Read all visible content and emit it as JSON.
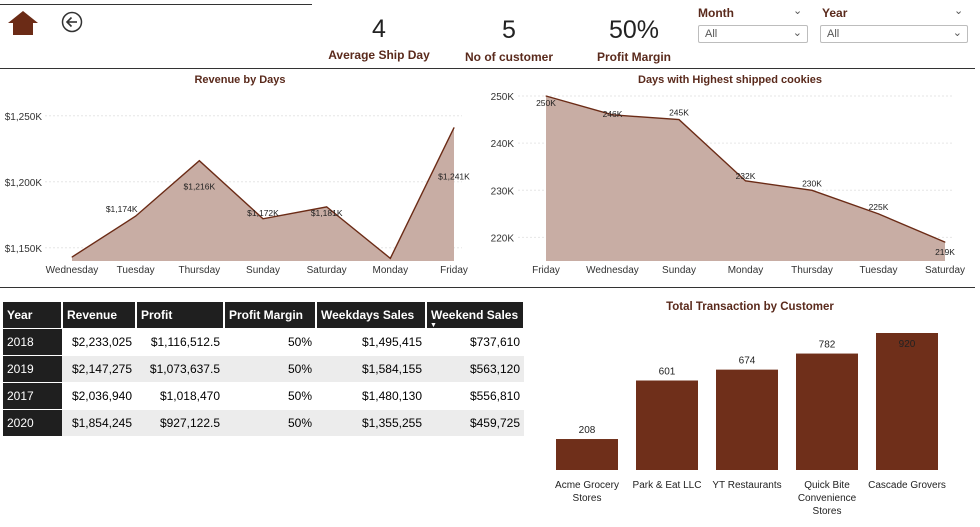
{
  "header": {
    "home_icon": "home-icon",
    "back_icon": "back-arrow-icon",
    "kpis": [
      {
        "value": "4",
        "label": "Average Ship Day"
      },
      {
        "value": "5",
        "label": "No of customer"
      },
      {
        "value": "50%",
        "label": "Profit Margin"
      }
    ],
    "slicers": [
      {
        "title": "Month",
        "value": "All"
      },
      {
        "title": "Year",
        "value": "All"
      }
    ]
  },
  "colors": {
    "accent": "#6b2b16",
    "area_fill": "#c8ada4",
    "area_line": "#6b2b16",
    "bar": "#6f2f1a",
    "table_header": "#1f1f1f"
  },
  "table": {
    "columns": [
      "Year",
      "Revenue",
      "Profit",
      "Profit Margin",
      "Weekdays Sales",
      "Weekend Sales"
    ],
    "sort_column": "Weekend Sales",
    "rows": [
      [
        "2018",
        "$2,233,025",
        "$1,116,512.5",
        "50%",
        "$1,495,415",
        "$737,610"
      ],
      [
        "2019",
        "$2,147,275",
        "$1,073,637.5",
        "50%",
        "$1,584,155",
        "$563,120"
      ],
      [
        "2017",
        "$2,036,940",
        "$1,018,470",
        "50%",
        "$1,480,130",
        "$556,810"
      ],
      [
        "2020",
        "$1,854,245",
        "$927,122.5",
        "50%",
        "$1,355,255",
        "$459,725"
      ]
    ]
  },
  "chart_data": [
    {
      "type": "area",
      "title": "Revenue by Days",
      "categories": [
        "Wednesday",
        "Tuesday",
        "Thursday",
        "Sunday",
        "Saturday",
        "Monday",
        "Friday"
      ],
      "values": [
        1143,
        1174,
        1216,
        1172,
        1181,
        1142,
        1241
      ],
      "data_labels": [
        "",
        "$1,174K",
        "$1,216K",
        "$1,172K",
        "$1,181K",
        "",
        "$1,241K"
      ],
      "yticks": [
        1150,
        1200,
        1250
      ],
      "ytick_labels": [
        "$1,150K",
        "$1,200K",
        "$1,250K"
      ],
      "ylim": [
        1140,
        1265
      ],
      "grid": true
    },
    {
      "type": "area",
      "title": "Days with Highest shipped cookies",
      "categories": [
        "Friday",
        "Wednesday",
        "Sunday",
        "Monday",
        "Thursday",
        "Tuesday",
        "Saturday"
      ],
      "values": [
        250,
        246,
        245,
        232,
        230,
        225,
        219
      ],
      "data_labels": [
        "250K",
        "246K",
        "245K",
        "232K",
        "230K",
        "225K",
        "219K"
      ],
      "yticks": [
        220,
        230,
        240,
        250
      ],
      "ytick_labels": [
        "220K",
        "230K",
        "240K",
        "250K"
      ],
      "ylim": [
        215,
        250
      ],
      "grid": true
    },
    {
      "type": "bar",
      "title": "Total Transaction by Customer",
      "categories": [
        "Acme Grocery Stores",
        "Park & Eat LLC",
        "YT Restaurants",
        "Quick Bite Convenience Stores",
        "Cascade Grovers"
      ],
      "category_lines": [
        [
          "Acme Grocery",
          "Stores"
        ],
        [
          "Park & Eat LLC"
        ],
        [
          "YT Restaurants"
        ],
        [
          "Quick Bite",
          "Convenience",
          "Stores"
        ],
        [
          "Cascade Grovers"
        ]
      ],
      "values": [
        208,
        601,
        674,
        782,
        920
      ],
      "ylim": [
        0,
        920
      ]
    }
  ]
}
